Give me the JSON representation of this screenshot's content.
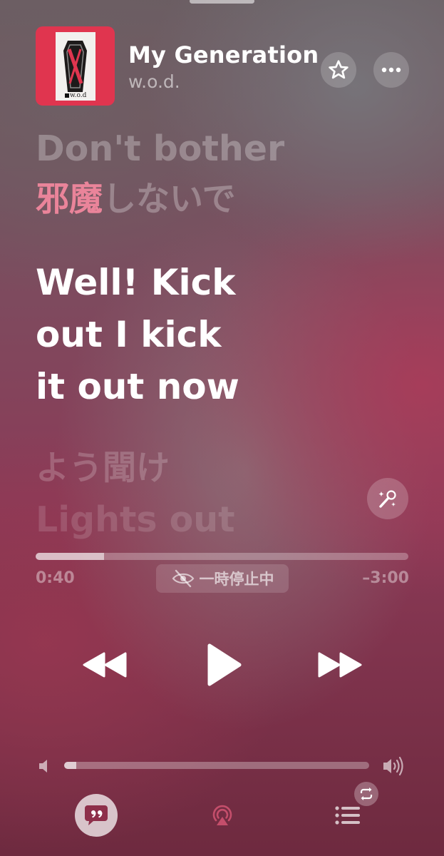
{
  "now_playing": {
    "title": "My Generation",
    "artist": "w.o.d.",
    "artwork_icon": "album-art-coffin",
    "artwork_label": "w.o.d"
  },
  "lyrics": {
    "previous_line_1": "Don't bother",
    "previous_line_2_highlight": "邪魔",
    "previous_line_2_rest": "しないで",
    "current_line": [
      "Well! Kick",
      "out I kick",
      "it out now"
    ],
    "next_line_1": "よう聞け",
    "next_line_2": "Lights out"
  },
  "playback": {
    "elapsed": "0:40",
    "remaining": "–3:00",
    "progress_fraction": 0.184,
    "status_label": "一時停止中",
    "status_icon": "listening-paused-icon",
    "state": "paused"
  },
  "volume": {
    "level_fraction": 0.04
  },
  "icons": {
    "favorite": "star-icon",
    "more": "ellipsis-icon",
    "sing": "microphone-sparkle-icon",
    "rewind": "rewind-icon",
    "play": "play-icon",
    "forward": "fast-forward-icon",
    "lyrics": "lyrics-quote-icon",
    "airplay": "airplay-icon",
    "queue": "queue-list-icon",
    "repeat": "repeat-icon"
  },
  "colors": {
    "artwork_background": "#e0354f",
    "lyric_highlight": "#ff8ca5"
  }
}
